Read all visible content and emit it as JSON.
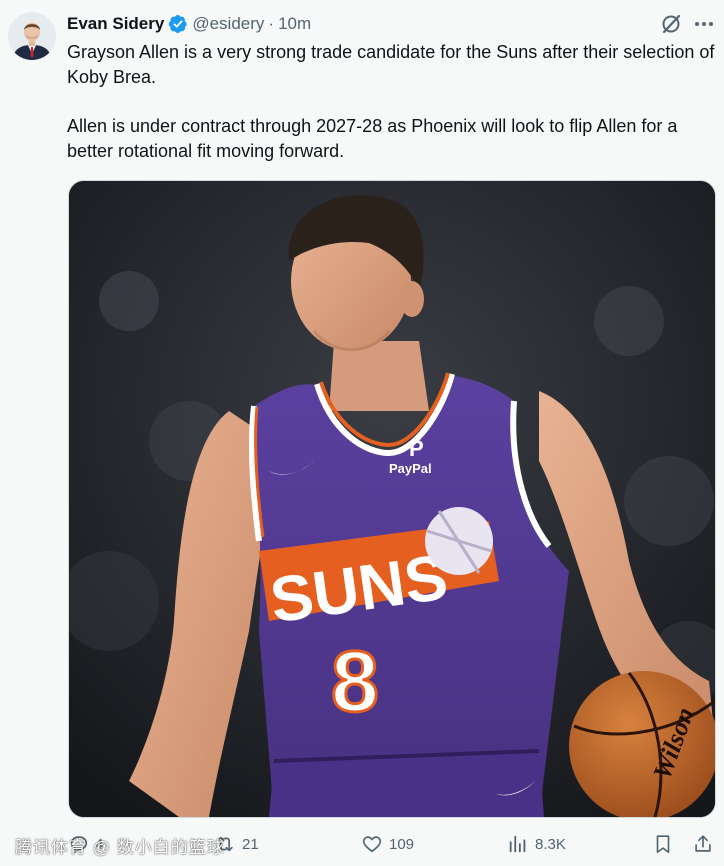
{
  "author": {
    "name": "Evan Sidery",
    "handle": "@esidery",
    "separator": "·",
    "time": "10m"
  },
  "icons": {
    "verified": "verified-badge-icon",
    "grok": "grok-icon",
    "more": "more-icon",
    "reply": "reply-icon",
    "retweet": "retweet-icon",
    "like": "heart-icon",
    "views": "views-icon",
    "bookmark": "bookmark-icon",
    "share": "share-icon"
  },
  "colors": {
    "accent": "#1d9bf0",
    "suns_purple": "#5a3f99",
    "suns_orange": "#e56020"
  },
  "tweet": {
    "paragraph_1": "Grayson Allen is a very strong trade candidate for the Suns after their selection of Koby Brea.",
    "paragraph_2": "Allen is under contract through 2027-28 as Phoenix will look to flip Allen for a better rotational fit moving forward."
  },
  "media": {
    "jersey_sponsor": "PayPal",
    "jersey_team": "SUNS",
    "jersey_number": "8",
    "ball_brand": "Wilson"
  },
  "actions": {
    "reply_count": "4",
    "retweet_count": "21",
    "like_count": "109",
    "views_count": "8.3K"
  },
  "watermark": "腾讯体育 @ 数小白的篮球"
}
